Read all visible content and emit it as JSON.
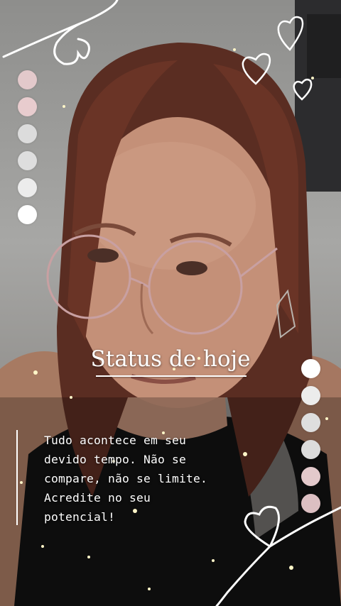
{
  "story": {
    "title": "Status de hoje",
    "quote": "Tudo acontece em seu\ndevido tempo. Não se\ncompare, não se limite.\nAcredite no seu\npotencial!"
  },
  "palette": {
    "left": [
      "#e3c9cb",
      "#e8ccce",
      "#dcdcdc",
      "#dedede",
      "#ececec",
      "#ffffff"
    ],
    "right": [
      "#ffffff",
      "#ececec",
      "#dedede",
      "#dcdcdc",
      "#e3c9cb",
      "#dcbfc2"
    ]
  },
  "icons": {
    "decoration": "heart-icon"
  }
}
